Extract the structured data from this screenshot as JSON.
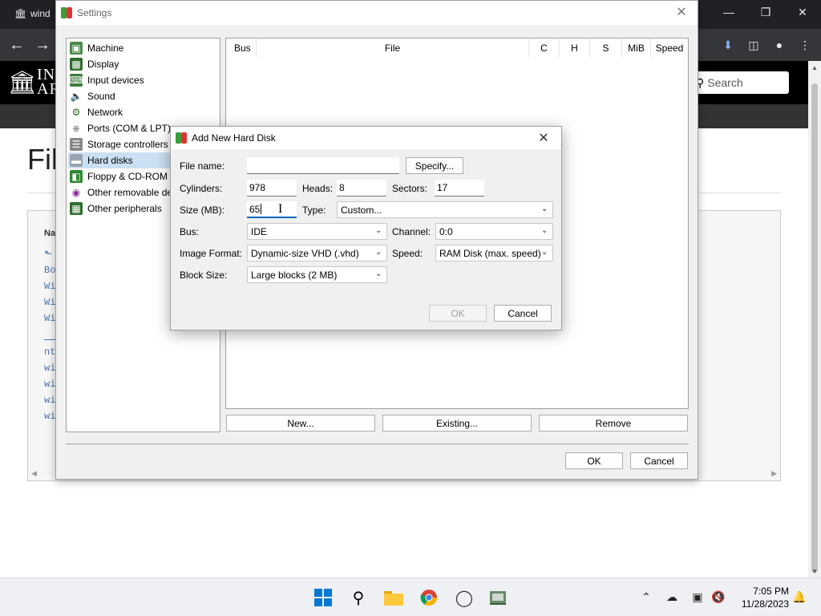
{
  "browser": {
    "tab_title": "wind",
    "ia_name_line1": "IN",
    "ia_name_line2": "AR",
    "search_placeholder": "Search",
    "page_title": "Fil",
    "file_list_header": "Na",
    "file_list_items": [
      "Bo",
      "Wi",
      "Wi",
      "Wi"
    ],
    "file_list_items2": [
      "nt",
      "wi",
      "wi",
      "wi",
      "wi"
    ]
  },
  "settings": {
    "title": "Settings",
    "categories": [
      {
        "label": "Machine",
        "icon": "machine-icon",
        "selected": false
      },
      {
        "label": "Display",
        "icon": "display-icon",
        "selected": false
      },
      {
        "label": "Input devices",
        "icon": "input-devices-icon",
        "selected": false
      },
      {
        "label": "Sound",
        "icon": "sound-icon",
        "selected": false
      },
      {
        "label": "Network",
        "icon": "network-icon",
        "selected": false
      },
      {
        "label": "Ports (COM & LPT)",
        "icon": "ports-icon",
        "selected": false
      },
      {
        "label": "Storage controllers",
        "icon": "storage-icon",
        "selected": false
      },
      {
        "label": "Hard disks",
        "icon": "hard-disk-icon",
        "selected": true
      },
      {
        "label": "Floppy & CD-ROM d",
        "icon": "floppy-icon",
        "selected": false
      },
      {
        "label": "Other removable de",
        "icon": "removable-icon",
        "selected": false
      },
      {
        "label": "Other peripherals",
        "icon": "peripherals-icon",
        "selected": false
      }
    ],
    "table_columns": [
      "Bus",
      "File",
      "C",
      "H",
      "S",
      "MiB",
      "Speed"
    ],
    "buttons": {
      "new": "New...",
      "existing": "Existing...",
      "remove": "Remove",
      "ok": "OK",
      "cancel": "Cancel"
    }
  },
  "dialog": {
    "title": "Add New Hard Disk",
    "file_name_label": "File name:",
    "file_name_value": "",
    "specify_label": "Specify...",
    "cylinders_label": "Cylinders:",
    "cylinders_value": "978",
    "heads_label": "Heads:",
    "heads_value": "8",
    "sectors_label": "Sectors:",
    "sectors_value": "17",
    "size_label": "Size (MB):",
    "size_value": "65",
    "type_label": "Type:",
    "type_value": "Custom...",
    "bus_label": "Bus:",
    "bus_value": "IDE",
    "channel_label": "Channel:",
    "channel_value": "0:0",
    "format_label": "Image Format:",
    "format_value": "Dynamic-size VHD (.vhd)",
    "speed_label": "Speed:",
    "speed_value": "RAM Disk (max. speed)",
    "block_size_label": "Block Size:",
    "block_size_value": "Large blocks (2 MB)",
    "ok_label": "OK",
    "cancel_label": "Cancel"
  },
  "taskbar": {
    "time": "7:05 PM",
    "date": "11/28/2023"
  }
}
